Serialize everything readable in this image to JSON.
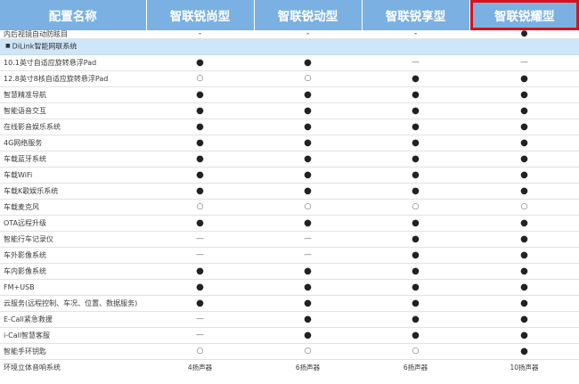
{
  "table": {
    "header": {
      "name_col": "配置名称",
      "trims": [
        "智联锐尚型",
        "智联锐动型",
        "智联锐享型",
        "智联锐耀型"
      ],
      "highlighted_trim": 3,
      "highlight_color": "#d6121c",
      "header_bg": "#7ab1e2",
      "section_bg": "#cfe6f8"
    },
    "top_row": {
      "label": "内后视镜自动防眩目",
      "values": [
        "-",
        "-",
        "-",
        "●"
      ]
    },
    "section": {
      "marker": "■",
      "label": "DiLink智能网联系统"
    },
    "rows": [
      {
        "label": "10.1英寸自适应旋转悬浮Pad",
        "values": [
          "●",
          "●",
          "—",
          "—"
        ]
      },
      {
        "label": "12.8英寸8核自适应旋转悬浮Pad",
        "values": [
          "○",
          "○",
          "●",
          "●"
        ]
      },
      {
        "label": "智慧精准导航",
        "values": [
          "●",
          "●",
          "●",
          "●"
        ]
      },
      {
        "label": "智能语音交互",
        "values": [
          "●",
          "●",
          "●",
          "●"
        ]
      },
      {
        "label": "在线影音娱乐系统",
        "values": [
          "●",
          "●",
          "●",
          "●"
        ]
      },
      {
        "label": "4G网络服务",
        "values": [
          "●",
          "●",
          "●",
          "●"
        ]
      },
      {
        "label": "车载蓝牙系统",
        "values": [
          "●",
          "●",
          "●",
          "●"
        ]
      },
      {
        "label": "车载WiFi",
        "values": [
          "●",
          "●",
          "●",
          "●"
        ]
      },
      {
        "label": "车载K歌娱乐系统",
        "values": [
          "●",
          "●",
          "●",
          "●"
        ]
      },
      {
        "label": "车载麦克风",
        "values": [
          "○",
          "○",
          "○",
          "○"
        ]
      },
      {
        "label": "OTA远程升级",
        "values": [
          "●",
          "●",
          "●",
          "●"
        ]
      },
      {
        "label": "智能行车记录仪",
        "values": [
          "—",
          "—",
          "●",
          "●"
        ]
      },
      {
        "label": "车外影像系统",
        "values": [
          "—",
          "—",
          "●",
          "●"
        ]
      },
      {
        "label": "车内影像系统",
        "values": [
          "●",
          "●",
          "●",
          "●"
        ]
      },
      {
        "label": "FM+USB",
        "values": [
          "●",
          "●",
          "●",
          "●"
        ]
      },
      {
        "label": "云服务(远程控制、车况、位置、数据服务)",
        "values": [
          "●",
          "●",
          "●",
          "●"
        ]
      },
      {
        "label": "E-Call紧急救援",
        "values": [
          "—",
          "●",
          "●",
          "●"
        ]
      },
      {
        "label": "i-Call智慧客服",
        "values": [
          "—",
          "●",
          "●",
          "●"
        ]
      },
      {
        "label": "智能手环钥匙",
        "values": [
          "○",
          "○",
          "○",
          "●"
        ]
      },
      {
        "label": "环境立体音响系统",
        "values": [
          "4扬声器",
          "6扬声器",
          "6扬声器",
          "10扬声器"
        ]
      }
    ]
  }
}
